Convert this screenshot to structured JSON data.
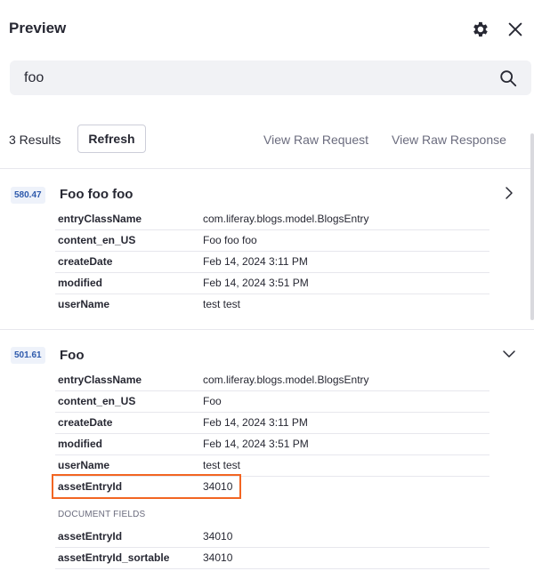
{
  "header": {
    "title": "Preview"
  },
  "icons": {
    "settings": "gear-icon",
    "close": "close-icon",
    "search": "search-icon",
    "expand": "chevron-right-icon",
    "collapse": "chevron-down-icon"
  },
  "search": {
    "value": "foo"
  },
  "toolbar": {
    "result_count": "3 Results",
    "refresh_label": "Refresh",
    "view_raw_request": "View Raw Request",
    "view_raw_response": "View Raw Response"
  },
  "results": [
    {
      "score": "580.47",
      "title": "Foo foo foo",
      "expanded": false,
      "fields": [
        {
          "key": "entryClassName",
          "value": "com.liferay.blogs.model.BlogsEntry"
        },
        {
          "key": "content_en_US",
          "value": "Foo foo foo"
        },
        {
          "key": "createDate",
          "value": "Feb 14, 2024 3:11 PM"
        },
        {
          "key": "modified",
          "value": "Feb 14, 2024 3:51 PM"
        },
        {
          "key": "userName",
          "value": "test test"
        }
      ]
    },
    {
      "score": "501.61",
      "title": "Foo",
      "expanded": true,
      "fields": [
        {
          "key": "entryClassName",
          "value": "com.liferay.blogs.model.BlogsEntry"
        },
        {
          "key": "content_en_US",
          "value": "Foo"
        },
        {
          "key": "createDate",
          "value": "Feb 14, 2024 3:11 PM"
        },
        {
          "key": "modified",
          "value": "Feb 14, 2024 3:51 PM"
        },
        {
          "key": "userName",
          "value": "test test"
        },
        {
          "key": "assetEntryId",
          "value": "34010"
        }
      ],
      "document_fields_label": "DOCUMENT FIELDS",
      "document_fields": [
        {
          "key": "assetEntryId",
          "value": "34010"
        },
        {
          "key": "assetEntryId_sortable",
          "value": "34010"
        }
      ]
    }
  ],
  "colors": {
    "score_bg": "#eef2fa",
    "score_text": "#2e5aac",
    "highlight": "#f26522"
  }
}
